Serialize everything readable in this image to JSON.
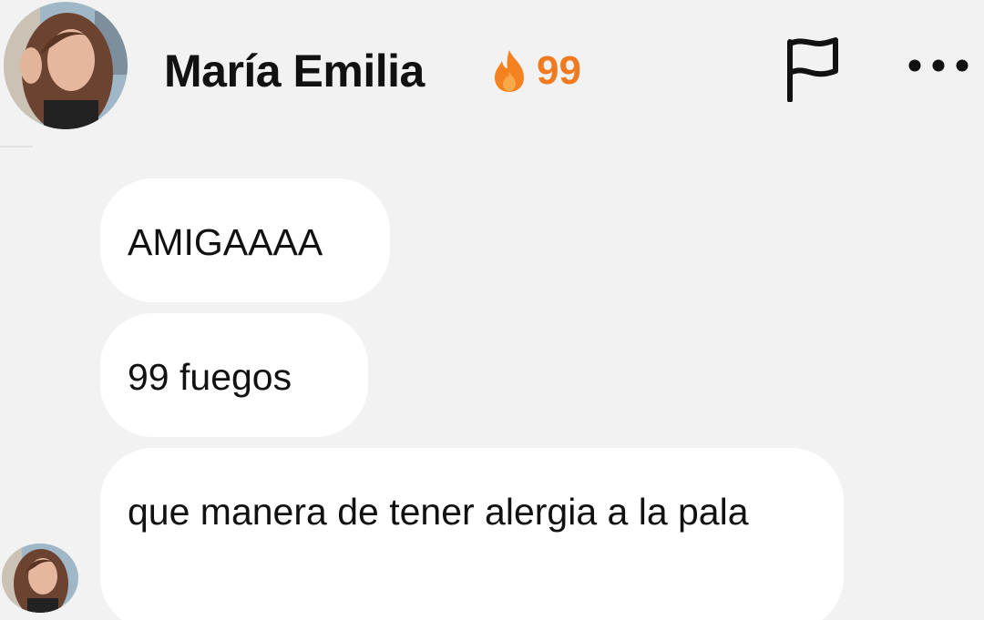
{
  "header": {
    "contact_name": "María Emilia",
    "streak_icon": "fire-icon",
    "streak_count": "99",
    "flag_icon": "flag-icon",
    "more_icon": "more-dots-icon"
  },
  "messages": [
    {
      "text": "AMIGAAAA"
    },
    {
      "text": "99 fuegos"
    },
    {
      "text": "que manera de tener alergia a la pala"
    }
  ],
  "colors": {
    "background": "#f2f2f2",
    "bubble": "#ffffff",
    "streak": "#f07a1f",
    "text": "#111111"
  }
}
